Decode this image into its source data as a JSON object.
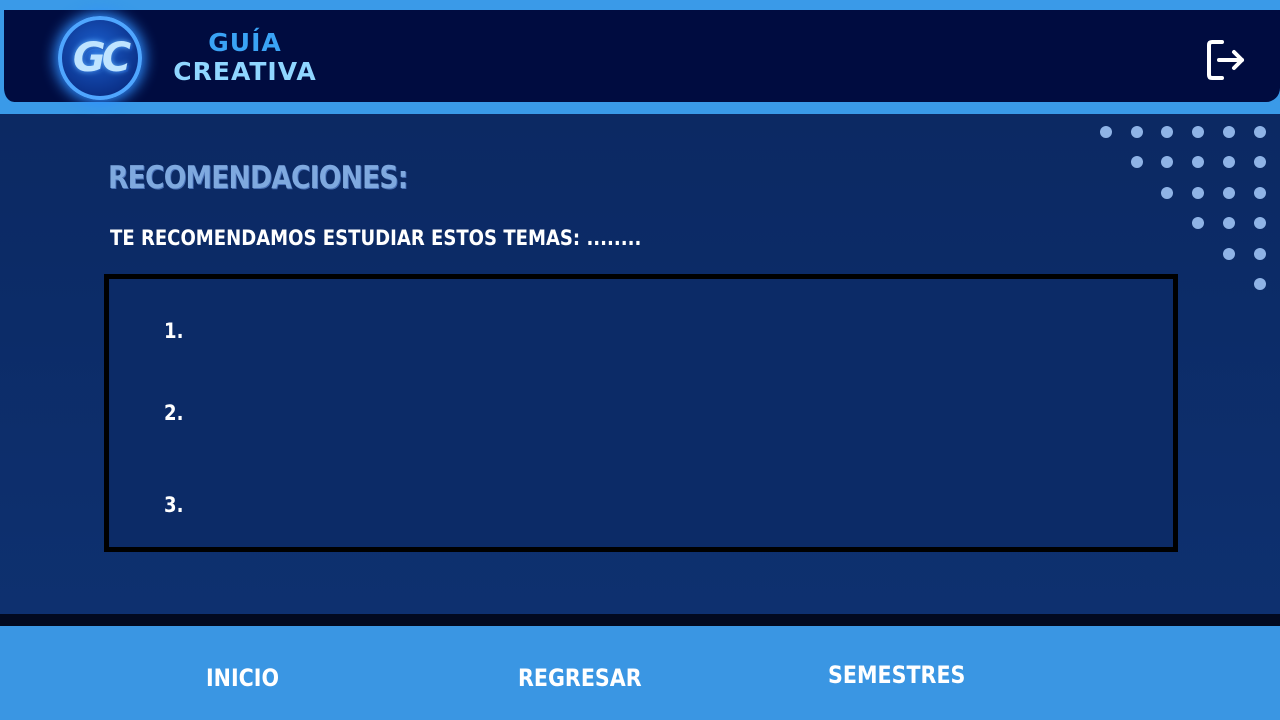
{
  "header": {
    "logo_text": "GC",
    "brand_line1": "GUÍA",
    "brand_line2": "CREATIVA",
    "logout_icon": "logout-icon"
  },
  "main": {
    "title": "RECOMENDACIONES:",
    "subtitle": "TE RECOMENDAMOS ESTUDIAR ESTOS TEMAS: ........",
    "topics": [
      "1.",
      "2.",
      "3."
    ]
  },
  "footer": {
    "nav": [
      "INICIO",
      "REGRESAR",
      "SEMESTRES"
    ]
  },
  "colors": {
    "header_bg": "#000c40",
    "accent": "#3a9ae8",
    "page_bg": "#0c2a66",
    "title": "#7fa9df",
    "dots": "#8fb3e6"
  }
}
